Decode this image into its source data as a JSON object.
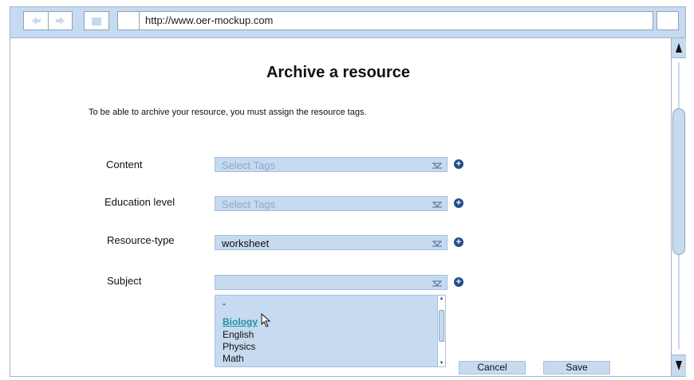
{
  "browser": {
    "url": "http://www.oer-mockup.com"
  },
  "page": {
    "title": "Archive a resource",
    "intro": "To be able to archive your resource, you must assign the resource tags."
  },
  "fields": [
    {
      "label": "Content",
      "value": "Select Tags",
      "placeholder": true
    },
    {
      "label": "Education level",
      "value": "Select Tags",
      "placeholder": true
    },
    {
      "label": "Resource-type",
      "value": "worksheet",
      "placeholder": false
    },
    {
      "label": "Subject",
      "value": "",
      "placeholder": false
    }
  ],
  "subject_options": [
    "-",
    "Biology",
    "English",
    "Physics",
    "Math"
  ],
  "subject_highlighted": "Biology",
  "buttons": {
    "cancel": "Cancel",
    "save": "Save"
  },
  "icons": {
    "back": "back-arrow-icon",
    "forward": "forward-arrow-icon",
    "home": "home-icon",
    "add": "add-circle-icon",
    "dropdown": "chevron-down-icon",
    "cursor": "mouse-pointer-icon"
  },
  "colors": {
    "chrome": "#c6daf0",
    "border": "#9fb4cc",
    "accent": "#244f8e",
    "placeholder": "#8ca9cc",
    "link": "#1f8fa8"
  }
}
